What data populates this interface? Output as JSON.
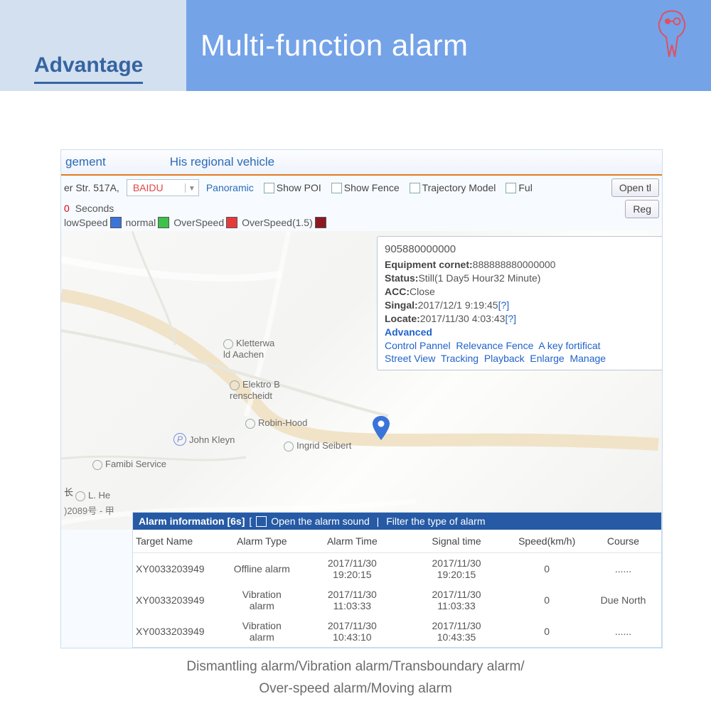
{
  "banner": {
    "left_label": "Advantage",
    "title": "Multi-function alarm"
  },
  "app": {
    "header_frag": "gement",
    "header_title2": "His regional vehicle",
    "addr_frag": "er Str. 517A,",
    "map_provider": "BAIDU",
    "panoramic": "Panoramic",
    "show_poi": "Show POI",
    "show_fence": "Show Fence",
    "traj_model": "Trajectory Model",
    "full_frag": "Ful",
    "seconds_prefix": "0",
    "seconds_label": " Seconds",
    "legend": {
      "lowspeed": "lowSpeed",
      "normal": "normal",
      "overspeed": "OverSpeed",
      "overspeed15": "OverSpeed(1.5)"
    },
    "btn_open": "Open tl",
    "btn_reg": "Reg"
  },
  "map": {
    "poi_kletterwa": "Kletterwa\nld Aachen",
    "poi_elektro": "Elektro B\nrenscheidt",
    "poi_robin": "Robin-Hood",
    "poi_john": "John Kleyn",
    "poi_ingrid": "Ingrid Seibert",
    "poi_famibi": "Famibi Service",
    "poi_lhe": "L. He",
    "scale": "长",
    "copy": ")2089号 - 甲"
  },
  "bubble": {
    "device_id": "905880000000",
    "equip_k": "Equipment cornet:",
    "equip_v": "888888880000000",
    "status_k": "Status:",
    "status_v": "Still(1 Day5 Hour32 Minute)",
    "acc_k": "ACC:",
    "acc_v": "Close",
    "singal_k": "Singal:",
    "singal_v": "2017/12/1 9:19:45",
    "locate_k": "Locate:",
    "locate_v": "2017/11/30 4:03:43",
    "q": "[?]",
    "advanced": "Advanced",
    "cp": "Control Pannel",
    "rf": "Relevance Fence",
    "akf": "A key fortificat",
    "sv": "Street View",
    "tr": "Tracking",
    "pb": "Playback",
    "en": "Enlarge",
    "mg": "Manage"
  },
  "alarm": {
    "title": "Alarm information [6s]",
    "open_sound": "Open the alarm sound",
    "filter": "Filter the type of alarm",
    "cols": {
      "tn": "Target Name",
      "at": "Alarm Type",
      "alt": "Alarm Time",
      "st": "Signal time",
      "sp": "Speed(km/h)",
      "cs": "Course"
    },
    "rows": [
      {
        "tn": "XY0033203949",
        "at": "Offline alarm",
        "alt1": "2017/11/30",
        "alt2": "19:20:15",
        "st1": "2017/11/30",
        "st2": "19:20:15",
        "sp": "0",
        "cs": "......"
      },
      {
        "tn": "XY0033203949",
        "at": "Vibration alarm",
        "alt1": "2017/11/30",
        "alt2": "11:03:33",
        "st1": "2017/11/30",
        "st2": "11:03:33",
        "sp": "0",
        "cs": "Due North"
      },
      {
        "tn": "XY0033203949",
        "at": "Vibration alarm",
        "alt1": "2017/11/30",
        "alt2": "10:43:10",
        "st1": "2017/11/30",
        "st2": "10:43:35",
        "sp": "0",
        "cs": "......"
      }
    ]
  },
  "caption": {
    "line1": "Dismantling alarm/Vibration alarm/Transboundary alarm/",
    "line2": "Over-speed alarm/Moving alarm"
  }
}
